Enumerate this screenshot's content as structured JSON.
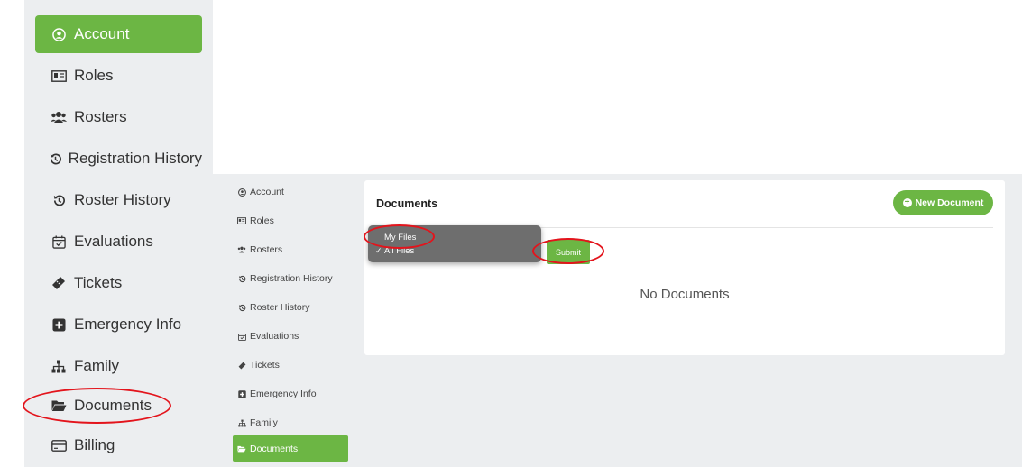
{
  "big_sidebar": {
    "items": [
      {
        "label": "Account",
        "icon": "user-circle-icon",
        "active": true
      },
      {
        "label": "Roles",
        "icon": "id-card-icon"
      },
      {
        "label": "Rosters",
        "icon": "users-icon"
      },
      {
        "label": "Registration History",
        "icon": "history-icon"
      },
      {
        "label": "Roster History",
        "icon": "history-icon"
      },
      {
        "label": "Evaluations",
        "icon": "calendar-check-icon"
      },
      {
        "label": "Tickets",
        "icon": "ticket-icon"
      },
      {
        "label": "Emergency Info",
        "icon": "plus-square-icon"
      },
      {
        "label": "Family",
        "icon": "sitemap-icon"
      },
      {
        "label": "Documents",
        "icon": "folder-open-icon"
      },
      {
        "label": "Billing",
        "icon": "credit-card-icon"
      }
    ]
  },
  "small_sidebar": {
    "items": [
      {
        "label": "Account",
        "icon": "user-circle-icon"
      },
      {
        "label": "Roles",
        "icon": "id-card-icon"
      },
      {
        "label": "Rosters",
        "icon": "users-icon"
      },
      {
        "label": "Registration History",
        "icon": "history-icon"
      },
      {
        "label": "Roster History",
        "icon": "history-icon"
      },
      {
        "label": "Evaluations",
        "icon": "calendar-check-icon"
      },
      {
        "label": "Tickets",
        "icon": "ticket-icon"
      },
      {
        "label": "Emergency Info",
        "icon": "plus-square-icon"
      },
      {
        "label": "Family",
        "icon": "sitemap-icon"
      },
      {
        "label": "Documents",
        "icon": "folder-open-icon",
        "active": true
      }
    ]
  },
  "documents": {
    "title": "Documents",
    "new_button": "New Document",
    "filter_options": [
      {
        "label": "My Files",
        "selected": false
      },
      {
        "label": "All Files",
        "selected": true
      }
    ],
    "check_mark": "✓",
    "submit_label": "Submit",
    "empty_text": "No Documents"
  },
  "colors": {
    "accent": "#6cb644",
    "annotation": "#e3141c"
  }
}
